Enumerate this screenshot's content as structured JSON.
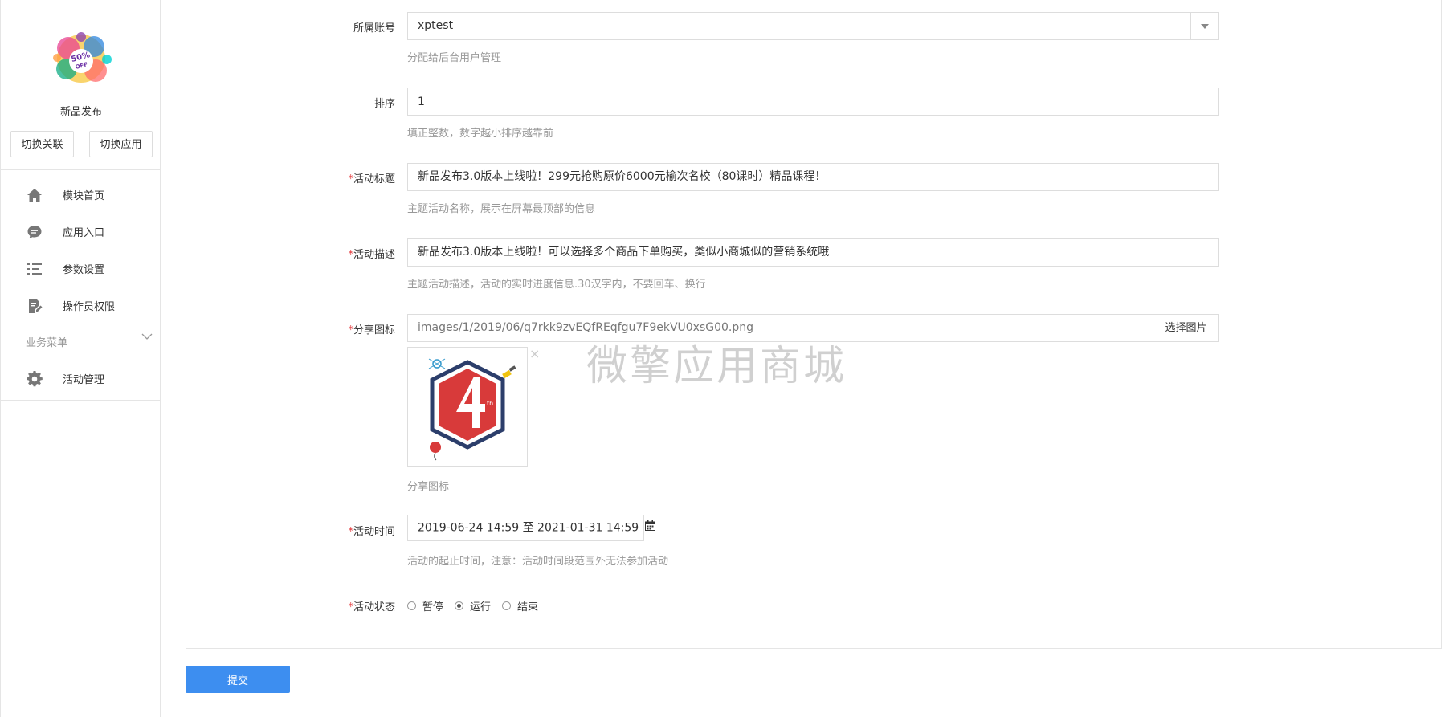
{
  "sidebar": {
    "app_name": "新品发布",
    "switch_link": "切换关联",
    "switch_app": "切换应用",
    "items": [
      {
        "label": "模块首页",
        "icon": "home-icon"
      },
      {
        "label": "应用入口",
        "icon": "chat-icon"
      },
      {
        "label": "参数设置",
        "icon": "list-settings-icon"
      },
      {
        "label": "操作员权限",
        "icon": "edit-document-icon"
      }
    ],
    "group_title": "业务菜单",
    "group_items": [
      {
        "label": "活动管理",
        "icon": "gear-icon"
      }
    ]
  },
  "form": {
    "account": {
      "label": "所属账号",
      "value": "xptest",
      "hint": "分配给后台用户管理"
    },
    "sort": {
      "label": "排序",
      "value": "1",
      "hint": "填正整数，数字越小排序越靠前"
    },
    "title": {
      "required": "*",
      "label": "活动标题",
      "value": "新品发布3.0版本上线啦！299元抢购原价6000元榆次名校（80课时）精品课程！",
      "hint": "主题活动名称，展示在屏幕最顶部的信息"
    },
    "desc": {
      "required": "*",
      "label": "活动描述",
      "value": "新品发布3.0版本上线啦！可以选择多个商品下单购买，类似小商城似的营销系统哦",
      "hint": "主题活动描述，活动的实时进度信息.30汉字内，不要回车、换行"
    },
    "share_icon": {
      "required": "*",
      "label": "分享图标",
      "value": "images/1/2019/06/q7rkk9zvEQfREqfgu7F9ekVU0xsG00.png",
      "button": "选择图片",
      "close": "×",
      "hint": "分享图标"
    },
    "time": {
      "required": "*",
      "label": "活动时间",
      "value": "2019-06-24 14:59 至 2021-01-31 14:59",
      "hint": "活动的起止时间，注意：活动时间段范围外无法参加活动"
    },
    "status": {
      "required": "*",
      "label": "活动状态",
      "options": [
        "暂停",
        "运行",
        "结束"
      ],
      "selected": "运行"
    }
  },
  "submit_label": "提交",
  "watermark": "微擎应用商城"
}
